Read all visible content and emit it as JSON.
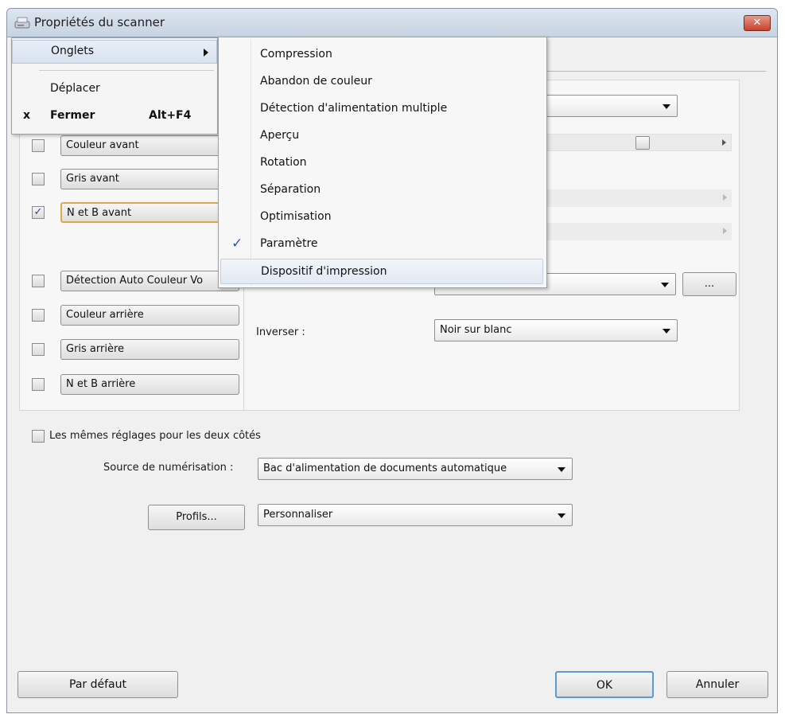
{
  "window": {
    "title": "Propriétés du scanner",
    "close_glyph": "✕",
    "icon": "scanner-icon"
  },
  "context_menu": {
    "items": [
      {
        "label": "Onglets",
        "has_submenu": true
      },
      {
        "label": "Déplacer"
      },
      {
        "prefix": "x",
        "label": "Fermer",
        "shortcut": "Alt+F4"
      }
    ]
  },
  "submenu": {
    "items": [
      {
        "label": "Compression"
      },
      {
        "label": "Abandon de couleur"
      },
      {
        "label": "Détection d'alimentation multiple"
      },
      {
        "label": "Aperçu"
      },
      {
        "label": "Rotation"
      },
      {
        "label": "Séparation"
      },
      {
        "label": "Optimisation"
      },
      {
        "label": "Paramètre",
        "checked": true
      },
      {
        "label": "Dispositif d'impression",
        "highlighted": true
      }
    ],
    "check_glyph": "✓"
  },
  "image_types": [
    {
      "label": "Couleur avant",
      "checked": false
    },
    {
      "label": "Gris avant",
      "checked": false
    },
    {
      "label": "N et B avant",
      "checked": true,
      "selected": true
    },
    {
      "label": "Détection Auto Couleur Vo",
      "checked": false
    },
    {
      "label": "Couleur arrière",
      "checked": false
    },
    {
      "label": "Gris arrière",
      "checked": false
    },
    {
      "label": "N et B arrière",
      "checked": false
    }
  ],
  "check_mark": "✓",
  "right_panel": {
    "invert_label": "Inverser :",
    "invert_value": "Noir sur blanc",
    "ellipsis_button": "..."
  },
  "same_settings": {
    "label": "Les mêmes réglages pour les deux côtés",
    "checked": false
  },
  "scan_source": {
    "label": "Source de numérisation :",
    "value": "Bac d'alimentation de documents automatique"
  },
  "profiles": {
    "button": "Profils...",
    "value": "Personnaliser"
  },
  "footer": {
    "default_button": "Par défaut",
    "ok_button": "OK",
    "cancel_button": "Annuler"
  }
}
